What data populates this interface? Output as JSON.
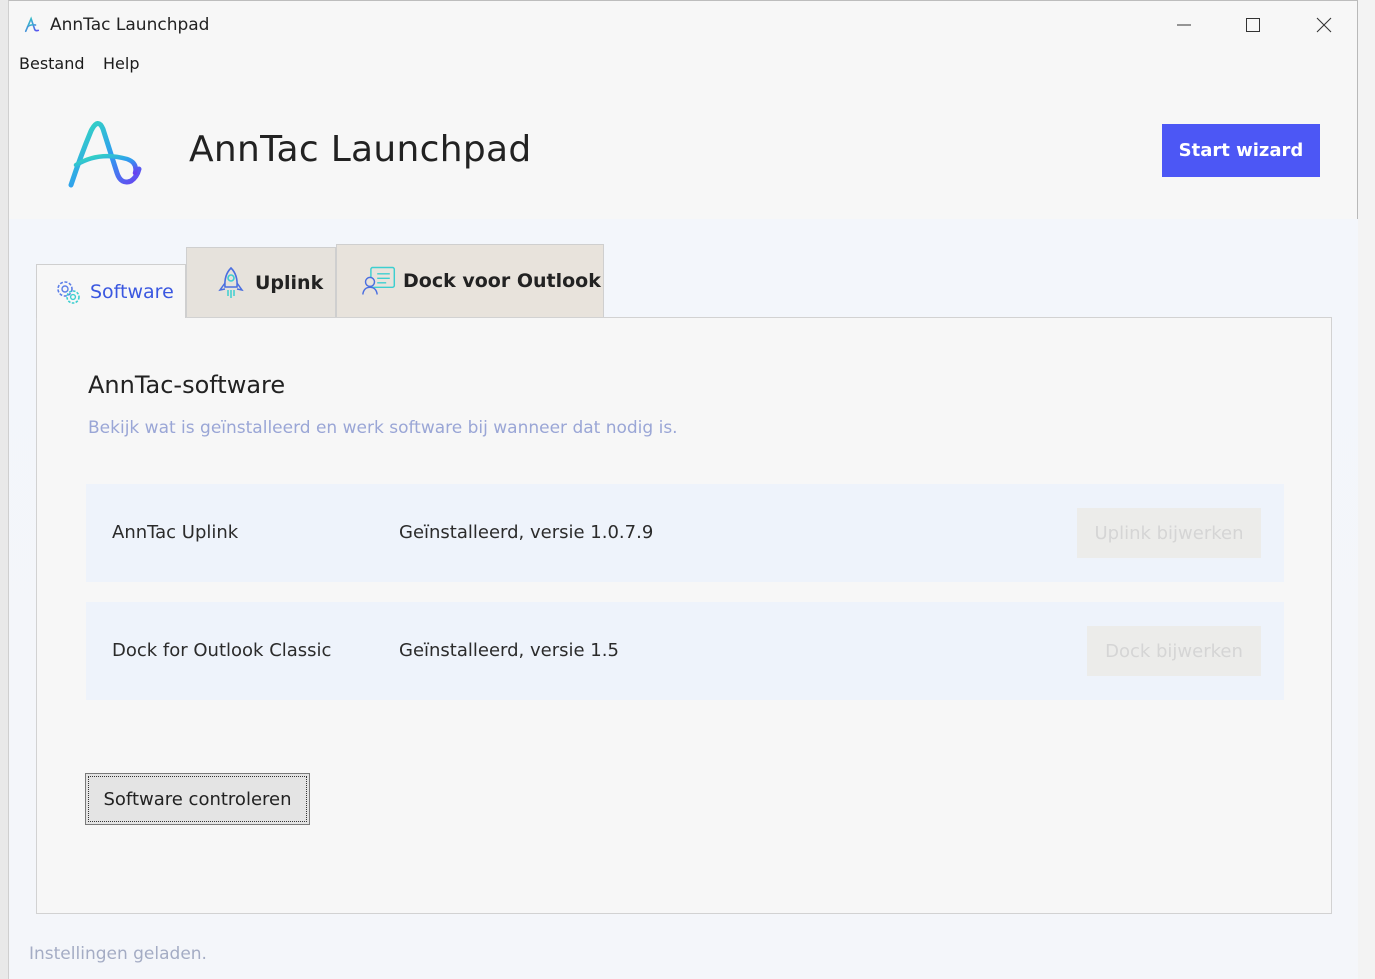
{
  "window": {
    "title": "AnnTac Launchpad"
  },
  "menu": {
    "items": [
      "Bestand",
      "Help"
    ]
  },
  "header": {
    "app_title": "AnnTac Launchpad",
    "start_wizard_label": "Start wizard"
  },
  "tabs": [
    {
      "label": "Software",
      "icon": "gear-cluster-icon",
      "active": true
    },
    {
      "label": "Uplink",
      "icon": "rocket-icon",
      "active": false
    },
    {
      "label": "Dock voor Outlook",
      "icon": "contact-card-icon",
      "active": false
    }
  ],
  "software": {
    "title": "AnnTac-software",
    "subtitle": "Bekijk wat is geïnstalleerd en werk software bij wanneer dat nodig is.",
    "rows": [
      {
        "name": "AnnTac Uplink",
        "status": "Geïnstalleerd, versie 1.0.7.9",
        "button": "Uplink bijwerken",
        "enabled": false
      },
      {
        "name": "Dock for Outlook Classic",
        "status": "Geïnstalleerd, versie 1.5",
        "button": "Dock bijwerken",
        "enabled": false
      }
    ],
    "check_button": "Software controleren"
  },
  "status_bar": {
    "text": "Instellingen geladen."
  },
  "colors": {
    "accent": "#4c57f5",
    "active_tab_text": "#3a57e0",
    "subtitle": "#9aa6d6",
    "disabled_text": "#d5d5d5"
  }
}
